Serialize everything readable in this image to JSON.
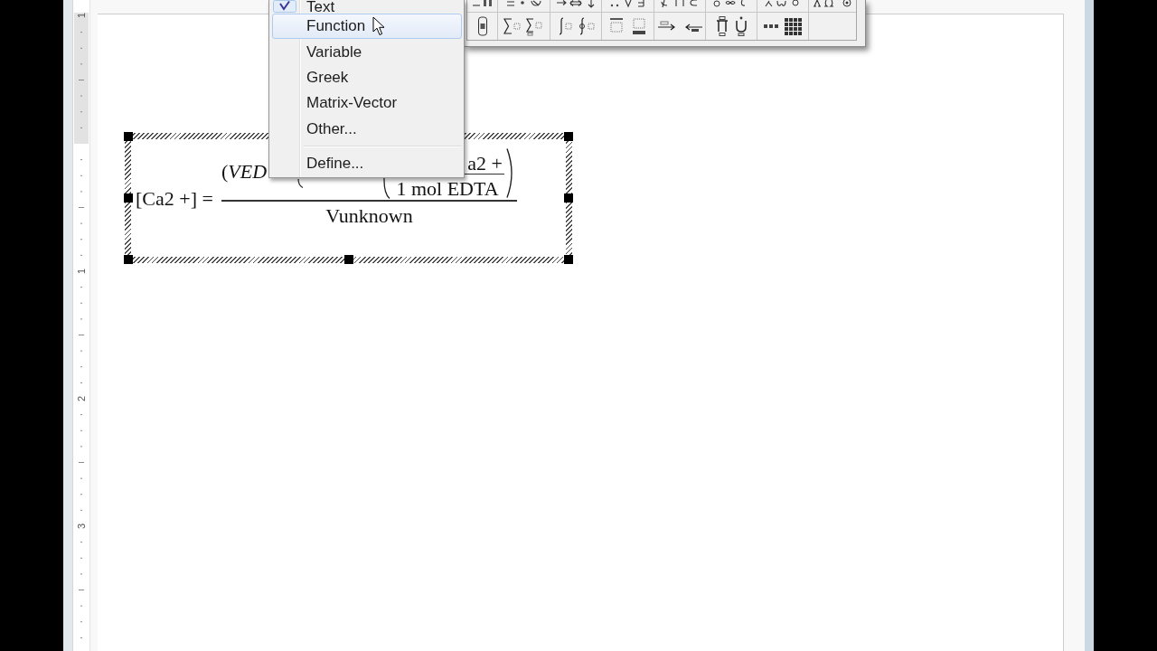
{
  "ruler": {
    "numbers": [
      "1",
      "1",
      "2",
      "3"
    ]
  },
  "equation": {
    "lhs": "[Ca2 +] =",
    "numerator_left": "(*VED*",
    "inner_numerator": "a2 +",
    "inner_denominator": "1 mol EDTA",
    "denominator": "Vunknown"
  },
  "menu": {
    "sections": [
      [
        {
          "label": "Text",
          "checked": true,
          "highlighted": false
        },
        {
          "label": "Function",
          "checked": false,
          "highlighted": true
        },
        {
          "label": "Variable",
          "checked": false,
          "highlighted": false
        },
        {
          "label": "Greek",
          "checked": false,
          "highlighted": false
        },
        {
          "label": "Matrix-Vector",
          "checked": false,
          "highlighted": false
        },
        {
          "label": "Other...",
          "checked": false,
          "highlighted": false
        }
      ],
      [
        {
          "label": "Define...",
          "checked": false,
          "highlighted": false
        }
      ]
    ]
  }
}
